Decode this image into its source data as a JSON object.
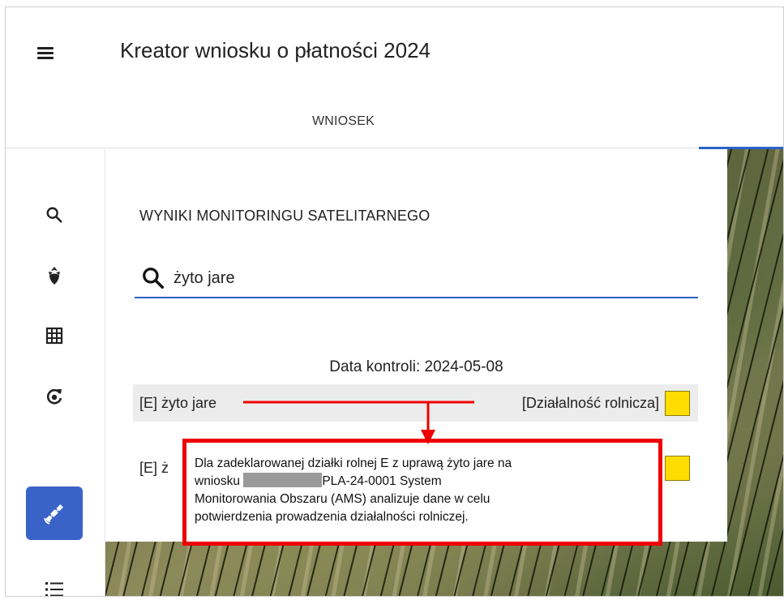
{
  "app": {
    "title": "Kreator wniosku o płatności 2024"
  },
  "tabs": [
    {
      "label": "WNIOSEK"
    }
  ],
  "sidebar": {
    "items": [
      {
        "icon": "search-icon"
      },
      {
        "icon": "beet-icon"
      },
      {
        "icon": "grid-map-icon"
      },
      {
        "icon": "refresh-cycle-icon"
      },
      {
        "icon": "satellite-icon",
        "active": true
      },
      {
        "icon": "list-icon"
      }
    ]
  },
  "panel": {
    "title": "WYNIKI MONITORINGU SATELITARNEGO",
    "search": {
      "value": "żyto jare"
    },
    "control_date": "Data kontroli: 2024-05-08",
    "rows": [
      {
        "crop": "[E] żyto jare",
        "activity": "[Działalność rolnicza]",
        "status_color": "#ffdd00"
      },
      {
        "crop": "[E] ż",
        "activity": "",
        "status_color": "#ffdd00"
      }
    ]
  },
  "callout": {
    "line1": "Dla zadeklarowanej działki rolnej E z uprawą żyto jare na",
    "line2_before": "wniosku",
    "line2_after": "PLA-24-0001 System",
    "line3": "Monitorowania Obszaru (AMS) analizuje dane w celu",
    "line4": "potwierdzenia prowadzenia działalności rolniczej.",
    "border_color": "#ee0000"
  }
}
